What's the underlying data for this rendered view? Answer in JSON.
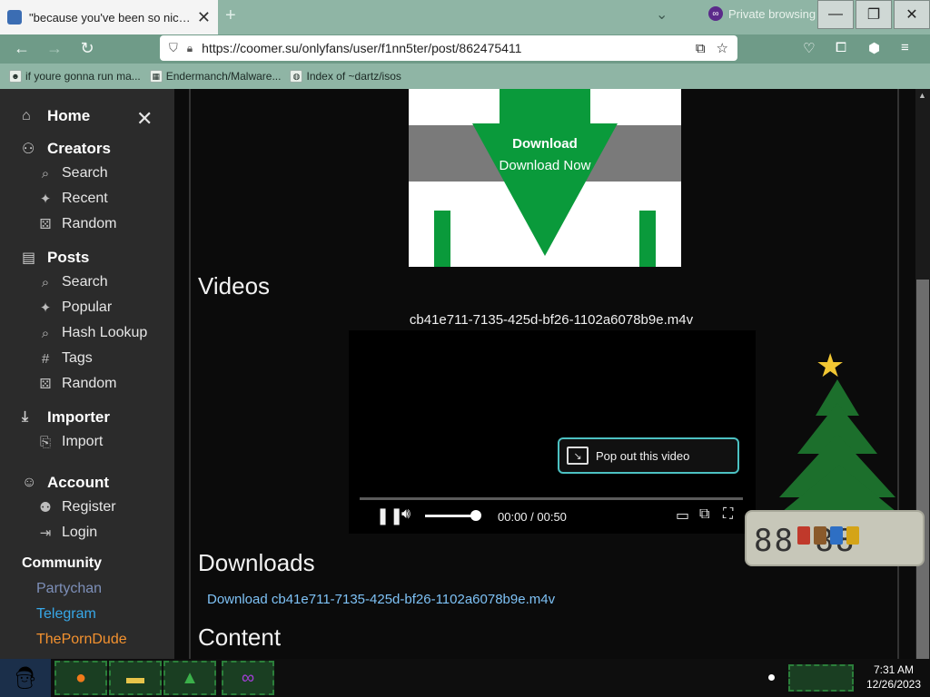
{
  "browser": {
    "tab_title": "\"because you've been so nice this",
    "private_label": "Private browsing",
    "url": "https://coomer.su/onlyfans/user/f1nn5ter/post/862475411",
    "bookmarks": [
      {
        "label": "if youre gonna run ma..."
      },
      {
        "label": "Endermanch/Malware..."
      },
      {
        "label": "Index of ~dartz/isos"
      }
    ]
  },
  "sidebar": {
    "home": "Home",
    "creators": {
      "label": "Creators",
      "items": [
        "Search",
        "Recent",
        "Random"
      ]
    },
    "posts": {
      "label": "Posts",
      "items": [
        "Search",
        "Popular",
        "Hash Lookup",
        "Tags",
        "Random"
      ]
    },
    "importer": {
      "label": "Importer",
      "items": [
        "Import"
      ]
    },
    "account": {
      "label": "Account",
      "items": [
        "Register",
        "Login"
      ]
    },
    "community": {
      "label": "Community",
      "links": [
        {
          "label": "Partychan",
          "color": "#7d8fb8"
        },
        {
          "label": "Telegram",
          "color": "#37a8e8"
        },
        {
          "label": "ThePornDude",
          "color": "#f4922f"
        }
      ]
    }
  },
  "ad": {
    "title": "Download",
    "subtitle": "Download Now"
  },
  "main": {
    "videos_heading": "Videos",
    "video_filename": "cb41e711-7135-425d-bf26-1102a6078b9e.m4v",
    "popout_label": "Pop out this video",
    "time_display": "00:00 / 00:50",
    "downloads_heading": "Downloads",
    "download_link": "Download cb41e711-7135-425d-bf26-1102a6078b9e.m4v",
    "content_heading": "Content"
  },
  "taskbar": {
    "time": "7:31 AM",
    "date": "12/26/2023"
  }
}
